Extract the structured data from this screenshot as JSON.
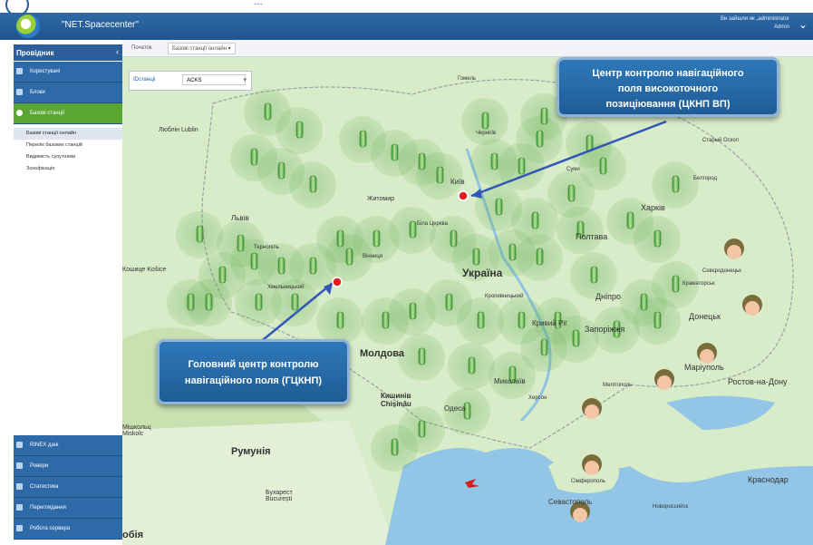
{
  "banner": {
    "text": "…"
  },
  "app": {
    "name": "\"NET.Spacecenter\""
  },
  "user": {
    "line1": "Ви зайшли як „administrator",
    "line2": "Admin"
  },
  "sidebar": {
    "title": "Провідник",
    "nav": [
      {
        "label": "Користувачі",
        "icon": "user-icon"
      },
      {
        "label": "Блоки",
        "icon": "block-icon"
      },
      {
        "label": "Базові станції",
        "icon": "station-icon",
        "active": true
      }
    ],
    "subitems": [
      "Базові станції онлайн",
      "Перелік базових станцій",
      "Видимість супутників",
      "Зонофікація"
    ],
    "bottom": [
      {
        "label": "RINEX дані",
        "icon": "rinex-icon"
      },
      {
        "label": "Ровери",
        "icon": "rover-icon"
      },
      {
        "label": "Статистика",
        "icon": "stats-icon"
      },
      {
        "label": "Переглядання",
        "icon": "view-icon"
      },
      {
        "label": "Робота сервера",
        "icon": "server-icon"
      }
    ]
  },
  "breadcrumb": {
    "root": "Початок",
    "current": "Базові станції онлайн ▾"
  },
  "filter": {
    "label": "IDстанціі",
    "value": "ACKS"
  },
  "callouts": {
    "top": [
      "Центр контролю навігаційного",
      "поля високоточного",
      "позиціювання (ЦКНП ВП)"
    ],
    "bottom": [
      "Головний центр контролю",
      "навігаційного поля (ГЦКНП)"
    ]
  },
  "map_labels": {
    "ukraine": "Україна",
    "moldova": "Молдова",
    "romania": "Румунія",
    "lublin": "Люблін Lublin",
    "lviv": "Львів",
    "kosice": "Кошице Košice",
    "kyiv": "Київ",
    "poltava": "Полтава",
    "kharkiv": "Харків",
    "dnipro": "Дніпро",
    "zaporizhzhia": "Запоріжжя",
    "kryvyi": "Кривий Ріг",
    "donetsk": "Донецьк",
    "mariupol": "Маріуполь",
    "rostov": "Ростов-на-Дону",
    "krasnodar": "Краснодар",
    "sevastopol": "Севастополь",
    "odesa": "Одеса",
    "chisinau": "Кишинів Chișinău",
    "bucharest": "Бухарест București",
    "mykolaiv": "Миколаїв",
    "zhytomyr": "Житомир",
    "kropyvnytskyi": "Кропивницький",
    "biala": "Біла Церква",
    "ternopil": "Тернопіль",
    "vinnytsia": "Вінниця",
    "chernihiv": "Чернігів",
    "belgorod": "Белгород",
    "kherson": "Херсон",
    "melitopol": "Мелітополь",
    "simferopol": "Сімферополь",
    "novorossiysk": "Новороссийск",
    "sofia": "обія",
    "khmelnytskyi": "Хмельницький",
    "mishkolts": "Мішкольц Miskolc",
    "sumy": "Суми",
    "homel": "Гомель",
    "staryi": "Старый Оскол",
    "kramatorsk": "Краматорськ",
    "sievierodonetsk": "Сєвєродонецьк"
  },
  "colors": {
    "topbar": "#2f6aa6",
    "active": "#5aa632",
    "callout": "#2f78b8",
    "sea": "#93c6e6",
    "land": "#dcefd0"
  }
}
